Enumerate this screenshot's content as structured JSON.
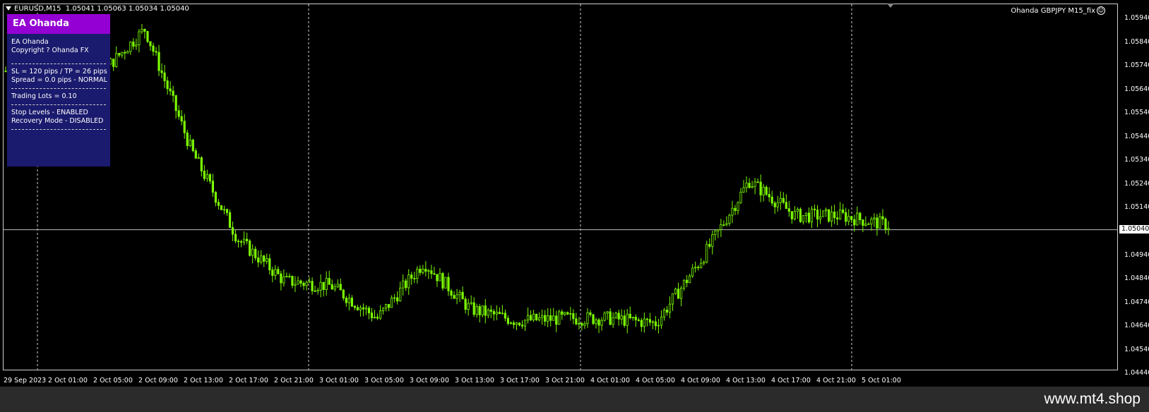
{
  "header": {
    "symbol": "EURUSD,M15",
    "ohlc": "1.05041 1.05063 1.05034 1.05040"
  },
  "indicator_label": "Ohanda GBPJPY M15_fix",
  "panel": {
    "title": "EA Ohanda",
    "line1": "EA Ohanda",
    "line2": "Copyright ? Ohanda FX",
    "line3": "SL = 120 pips / TP = 26 pips",
    "line4": "Spread = 0.0 pips - NORMAL",
    "line5": "Trading Lots = 0.10",
    "line6": "Stop Levels - ENABLED",
    "line7": "Recovery Mode - DISABLED"
  },
  "price_axis": {
    "labels": [
      "1.05940",
      "1.05840",
      "1.05740",
      "1.05640",
      "1.05540",
      "1.05440",
      "1.05340",
      "1.05240",
      "1.05140",
      "1.04940",
      "1.04840",
      "1.04740",
      "1.04640",
      "1.04540",
      "1.04440"
    ],
    "current": "1.05040"
  },
  "time_axis": {
    "labels": [
      "29 Sep 2023",
      "2 Oct 01:00",
      "2 Oct 05:00",
      "2 Oct 09:00",
      "2 Oct 13:00",
      "2 Oct 17:00",
      "2 Oct 21:00",
      "3 Oct 01:00",
      "3 Oct 05:00",
      "3 Oct 09:00",
      "3 Oct 13:00",
      "3 Oct 17:00",
      "3 Oct 21:00",
      "4 Oct 01:00",
      "4 Oct 05:00",
      "4 Oct 09:00",
      "4 Oct 13:00",
      "4 Oct 17:00",
      "4 Oct 21:00",
      "5 Oct 01:00"
    ]
  },
  "watermark": "www.mt4.shop",
  "colors": {
    "candle": "#7cfc00",
    "background": "#000000",
    "grid": "#cfcfcf",
    "panel": "#1a1a6e",
    "panel_title": "#9400d3"
  },
  "chart_data": {
    "type": "line",
    "title": "",
    "xlabel": "",
    "ylabel": "",
    "ylim": [
      1.044,
      1.06
    ],
    "x": [
      "29 Sep 2023",
      "2 Oct 01:00",
      "2 Oct 05:00",
      "2 Oct 09:00",
      "2 Oct 13:00",
      "2 Oct 17:00",
      "2 Oct 21:00",
      "3 Oct 01:00",
      "3 Oct 05:00",
      "3 Oct 09:00",
      "3 Oct 13:00",
      "3 Oct 17:00",
      "3 Oct 21:00",
      "4 Oct 01:00",
      "4 Oct 05:00",
      "4 Oct 09:00",
      "4 Oct 13:00",
      "4 Oct 17:00",
      "4 Oct 21:00",
      "5 Oct 01:00"
    ],
    "series": [
      {
        "values": [
          1.0572,
          1.0567,
          1.057,
          1.059,
          1.0538,
          1.05,
          1.0482,
          1.048,
          1.0466,
          1.049,
          1.047,
          1.0465,
          1.0466,
          1.0466,
          1.0464,
          1.0492,
          1.0525,
          1.051,
          1.051,
          1.0506
        ]
      }
    ]
  }
}
